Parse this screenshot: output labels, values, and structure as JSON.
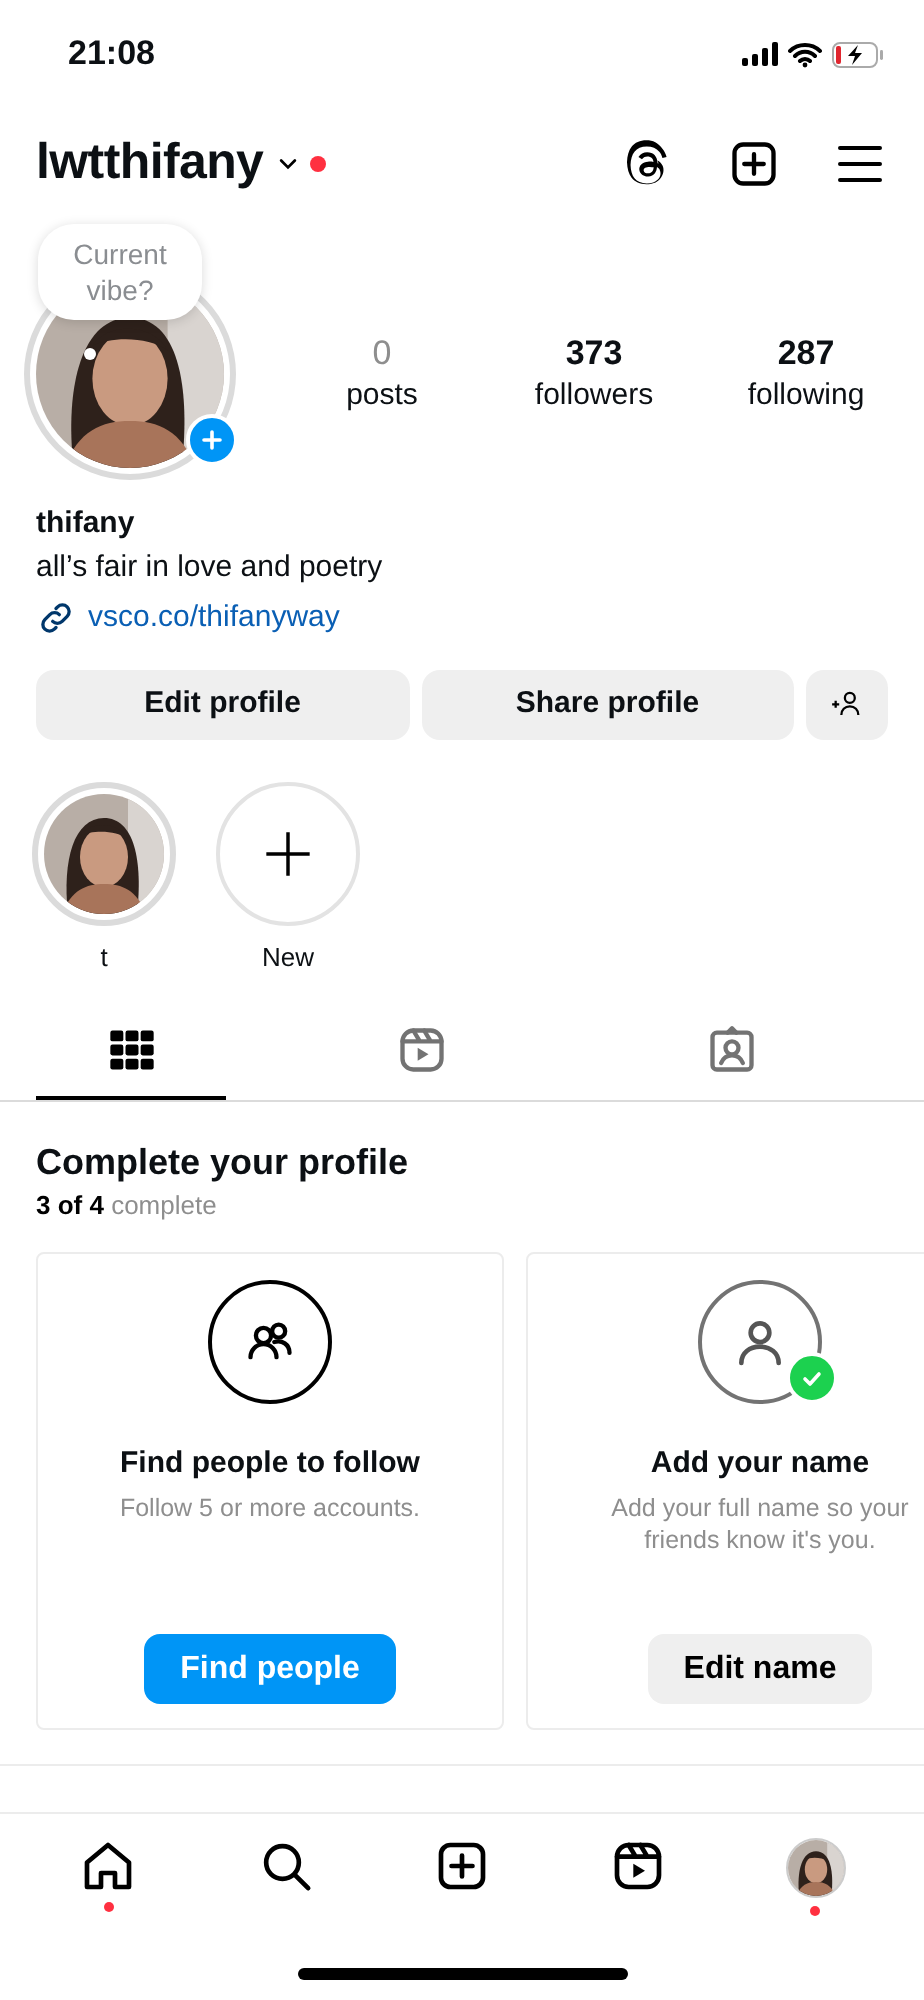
{
  "status_bar": {
    "time": "21:08"
  },
  "header": {
    "username": "lwtthifany",
    "notification": true
  },
  "profile": {
    "vibe": "Current vibe?",
    "stats": [
      {
        "value": "0",
        "label": "posts"
      },
      {
        "value": "373",
        "label": "followers"
      },
      {
        "value": "287",
        "label": "following"
      }
    ],
    "name": "thifany",
    "bio": "all’s fair in love and poetry",
    "link": "vsco.co/thifanyway"
  },
  "buttons": [
    "Edit profile",
    "Share profile"
  ],
  "highlights": [
    {
      "kind": "picture",
      "label": "t"
    },
    {
      "kind": "new",
      "label": "New"
    }
  ],
  "tabs": [
    {
      "kind": "grid",
      "selected": true
    },
    {
      "kind": "reels",
      "selected": false
    },
    {
      "kind": "tagged",
      "selected": false
    }
  ],
  "complete_profile": {
    "title": "Complete your profile",
    "progress": "**3 of 4** complete",
    "cards": [
      {
        "kind": "people",
        "done": false,
        "title": "Find people to follow",
        "text": "Follow 5 or more accounts.",
        "button": "Find people",
        "primary": true
      },
      {
        "kind": "name",
        "done": true,
        "title": "Add your name",
        "text": "Add your full name so your friends know it's you.",
        "button": "Edit name",
        "primary": false
      }
    ]
  },
  "nav": [
    {
      "kind": "home",
      "notification": true
    },
    {
      "kind": "search",
      "notification": false
    },
    {
      "kind": "create",
      "notification": false
    },
    {
      "kind": "reels",
      "notification": false
    },
    {
      "kind": "profile",
      "notification": true
    }
  ]
}
